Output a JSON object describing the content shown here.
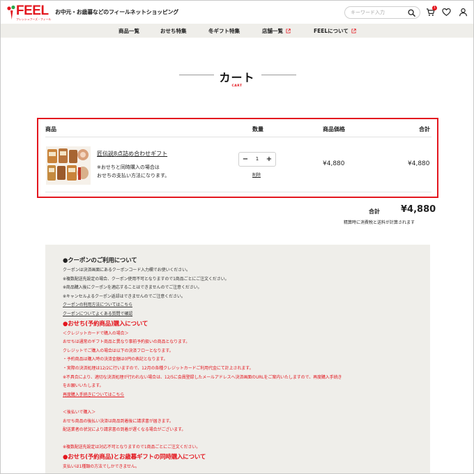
{
  "header": {
    "logo_text": "FEEL",
    "logo_sub": "フレッシュフーズ・フィール",
    "tagline": "お中元・お歳暮などのフィールネットショッピング",
    "search_placeholder": "キーワード入力",
    "cart_count": "1",
    "icons": [
      "search-icon",
      "cart-icon",
      "heart-icon",
      "user-icon"
    ]
  },
  "nav": {
    "items": [
      {
        "label": "商品一覧"
      },
      {
        "label": "おせち特集"
      },
      {
        "label": "冬ギフト特集"
      },
      {
        "label": "店舗一覧"
      },
      {
        "label": "FEELについて"
      }
    ]
  },
  "page": {
    "title": "カート",
    "subtitle": "CART"
  },
  "cart": {
    "columns": {
      "product": "商品",
      "qty": "数量",
      "price": "商品価格",
      "subtotal": "合計"
    },
    "items": [
      {
        "name": "匠伝説8点詰め合わせギフト",
        "note_1": "※おせちと同時購入の場合は",
        "note_2": "おせちの支払い方法になります。",
        "qty_minus": "−",
        "qty": "1",
        "qty_plus": "+",
        "delete": "削除",
        "price": "¥4,880",
        "subtotal": "¥4,880"
      }
    ],
    "total_label": "合計",
    "total_value": "¥4,880",
    "total_note": "精算時に消費税と送料が計算されます"
  },
  "info": {
    "coupon_title": "●クーポンのご利用について",
    "coupon_lines": [
      "クーポンは決済画面にあるクーポンコード入力欄でお使いください。",
      "※複数配送先設定の場合、クーポン使用不可となりますので1商品ごとにご注文ください。",
      "※商品購入後にクーポンを適応することはできませんのでご注意ください。",
      "※キャンセルよるクーポン返却はできませんのでご注意ください。"
    ],
    "coupon_link_1": "クーポンの利用方法についてはこちら",
    "coupon_link_2": "クーポンについてよくある質問で確認",
    "osechi_title": "●おせち(予約商品)購入について",
    "credit_heading": "＜クレジットカードで購入の場合＞",
    "credit_lines": [
      "おせちは通常のギフト商品と異なり事前予約扱いの商品となります。",
      "クレジットでご購入の場合は以下の決済フローとなります。",
      "・予約商品は購入時の決済金額は0円の表記となります。",
      "・実際の決済処理は12/2に行いますので、12月の各種クレジットカードご利用代金にて計上されます。",
      "※不具合により、適切な決済処理が行われない場合は、12/5に会員登録したメールアドレスへ決済画面のURLをご案内いたしますので、再度購入手続き",
      "をお願いいたします。"
    ],
    "repurchase_link": "再度購入手続きについてはこちら",
    "deferred_heading": "＜後払いで購入＞",
    "deferred_lines": [
      "おせち商品の後払い決済は商品到着後に請求書が届きます。",
      "配送業者の状況により請求書の到着が遅くなる場合がございます。"
    ],
    "multi_address_note": "※複数配送先設定は対応不可となりますので1商品ごとにご注文ください。",
    "simultaneous_title": "●おせち(予約商品)とお歳暮ギフトの同時購入について",
    "simultaneous_line": "支払いは1種類の方法でしかできません。"
  },
  "colors": {
    "brand_red": "#e3161e",
    "nav_bg": "#efeeea",
    "info_bg": "#efeeea"
  }
}
